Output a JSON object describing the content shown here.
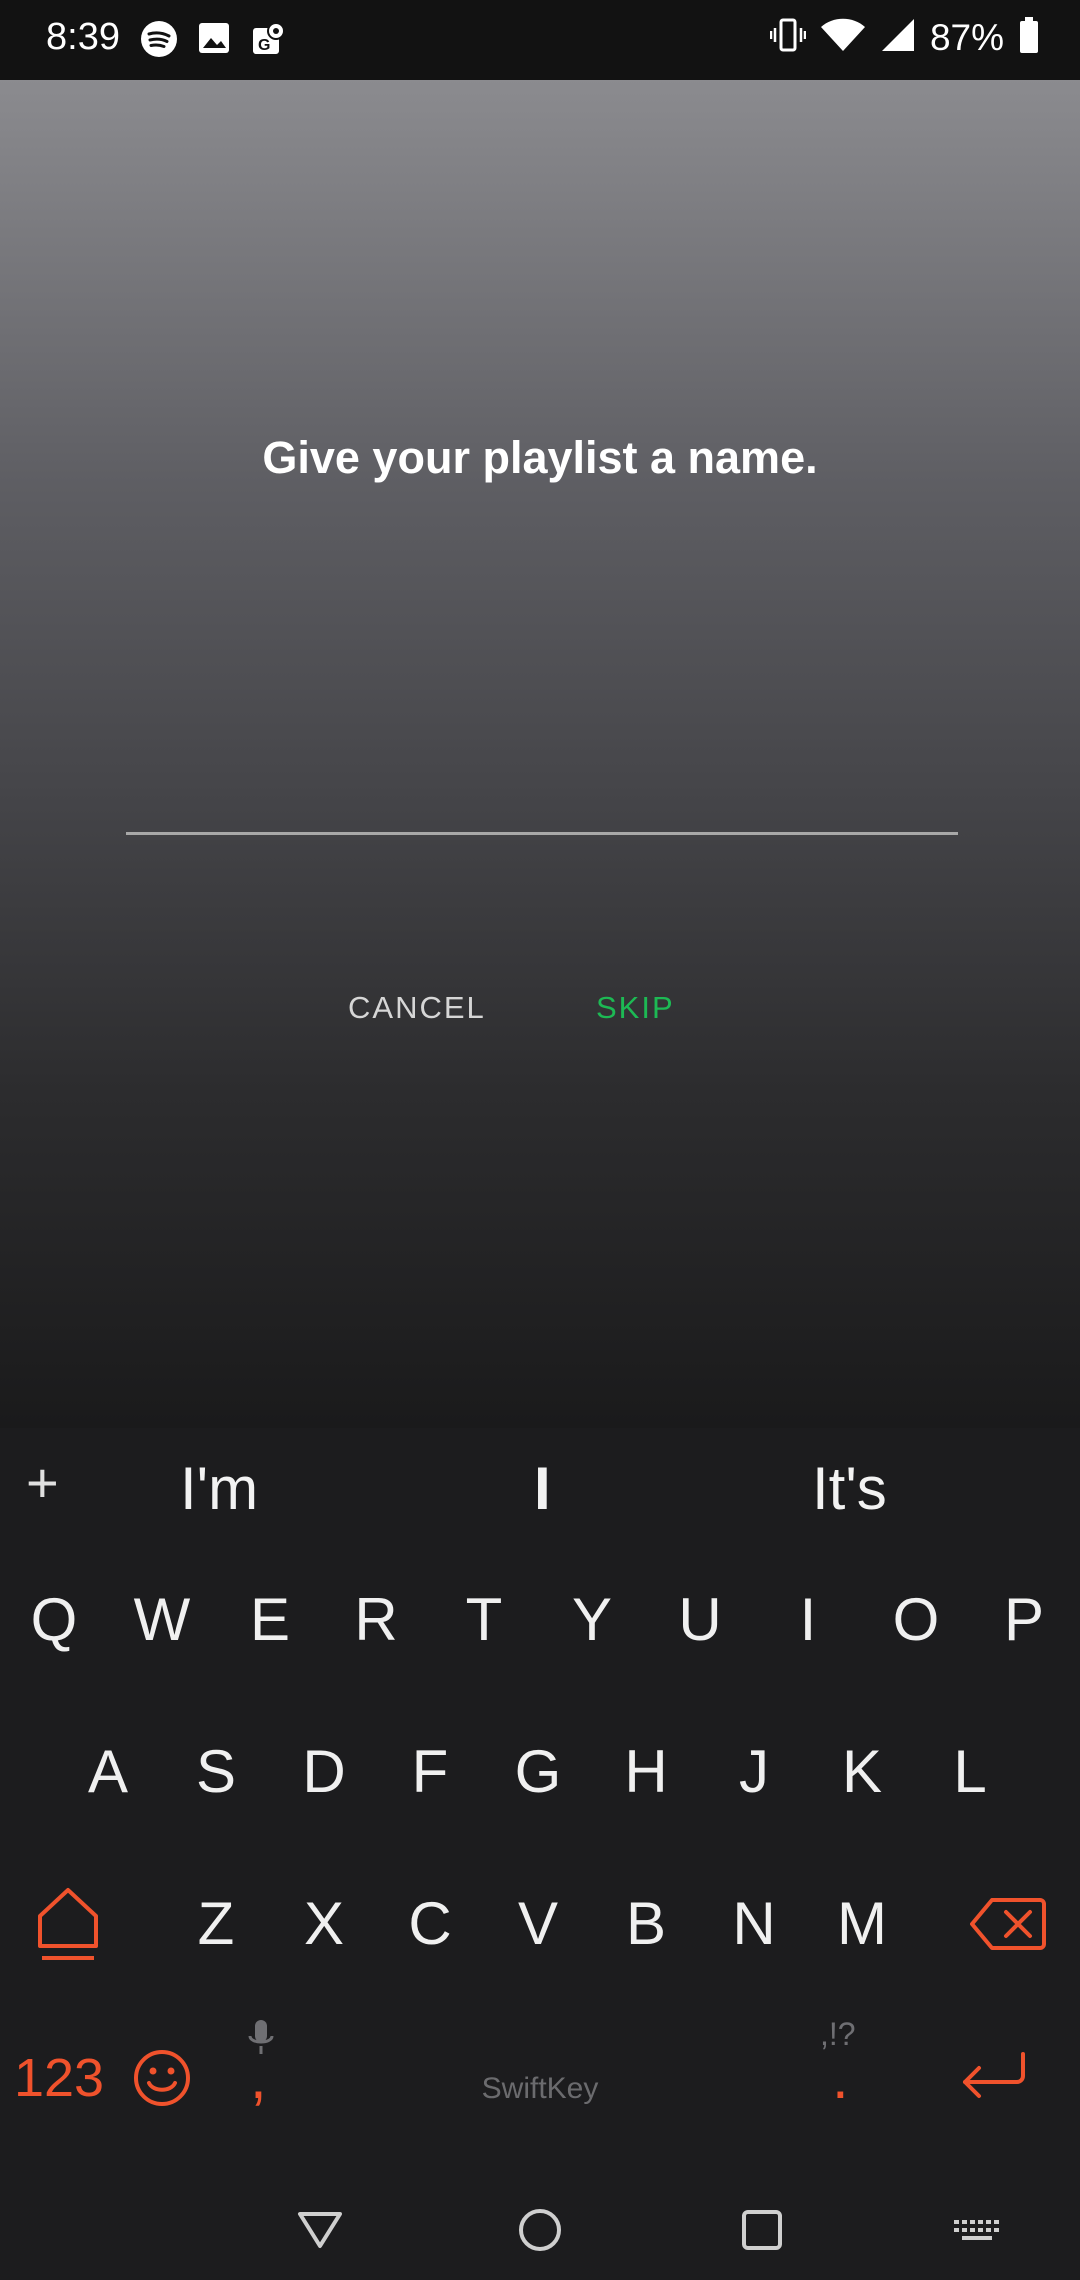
{
  "status_bar": {
    "time": "8:39",
    "battery_percent": "87%",
    "left_icons": [
      "spotify-icon",
      "image-icon",
      "maps-icon"
    ],
    "right_icons": [
      "vibrate-icon",
      "wifi-icon",
      "signal-icon",
      "battery-icon"
    ]
  },
  "dialog": {
    "title": "Give your playlist a name.",
    "input_value": "",
    "cancel_label": "CANCEL",
    "skip_label": "SKIP",
    "accent_color": "#1db954"
  },
  "keyboard": {
    "suggestions": [
      "I'm",
      "I",
      "It's"
    ],
    "add_label": "+",
    "row1": [
      "Q",
      "W",
      "E",
      "R",
      "T",
      "Y",
      "U",
      "I",
      "O",
      "P"
    ],
    "row2": [
      "A",
      "S",
      "D",
      "F",
      "G",
      "H",
      "J",
      "K",
      "L"
    ],
    "row3": [
      "Z",
      "X",
      "C",
      "V",
      "B",
      "N",
      "M"
    ],
    "numbers_label": "123",
    "comma_label": ",",
    "period_label": ".",
    "punct_hint": ",!?",
    "brand": "SwiftKey",
    "accent_color": "#f0522c"
  },
  "navigation": {
    "buttons": [
      "back-icon",
      "home-icon",
      "recents-icon",
      "keyboard-switch-icon"
    ]
  }
}
